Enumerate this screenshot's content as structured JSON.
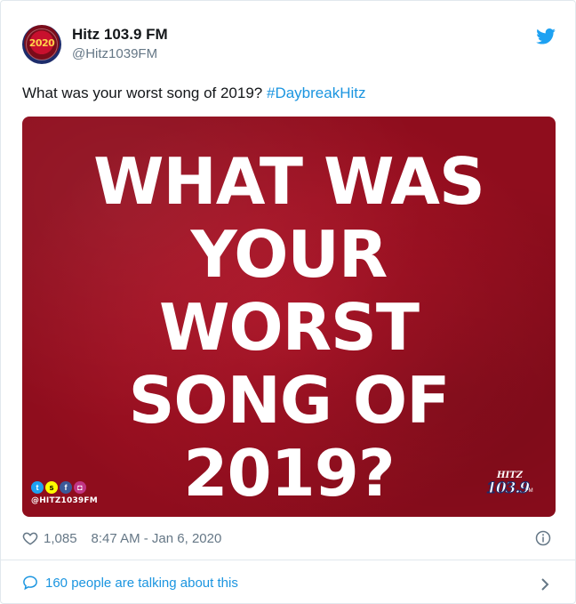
{
  "tweet": {
    "display_name": "Hitz 103.9 FM",
    "handle": "@Hitz1039FM",
    "avatar_text": "2020",
    "text": "What was your worst song of 2019? ",
    "hashtag": "#DaybreakHitz",
    "image": {
      "lines": [
        "WHAT WAS",
        "YOUR",
        "WORST",
        "SONG OF",
        "2019?"
      ],
      "social_handle": "@HITZ1039FM",
      "brand_top": "HITZ",
      "brand_main": "103.9",
      "brand_sub": "FM",
      "background_color": "#a3121f"
    },
    "likes": "1,085",
    "timestamp": "8:47 AM - Jan 6, 2020",
    "talking": "160 people are talking about this"
  },
  "icons": {
    "platform": "twitter-bird-icon",
    "like": "heart-icon",
    "info": "info-icon",
    "talk": "comment-bubble-icon",
    "more": "chevron-right-icon"
  },
  "colors": {
    "link": "#1b95e0",
    "muted": "#657786",
    "text": "#14171a",
    "border": "#e1e8ed"
  }
}
